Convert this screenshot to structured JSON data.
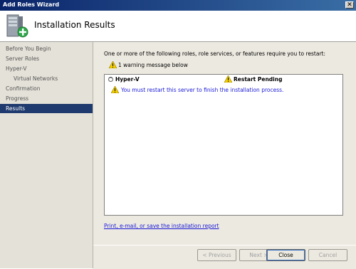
{
  "window": {
    "title": "Add Roles Wizard",
    "close_glyph": "✕"
  },
  "header": {
    "title": "Installation Results",
    "icon": "server-add-icon"
  },
  "sidebar": {
    "items": [
      {
        "label": "Before You Begin",
        "active": false,
        "sub": false
      },
      {
        "label": "Server Roles",
        "active": false,
        "sub": false
      },
      {
        "label": "Hyper-V",
        "active": false,
        "sub": false
      },
      {
        "label": "Virtual Networks",
        "active": false,
        "sub": true
      },
      {
        "label": "Confirmation",
        "active": false,
        "sub": false
      },
      {
        "label": "Progress",
        "active": false,
        "sub": false
      },
      {
        "label": "Results",
        "active": true,
        "sub": false
      }
    ]
  },
  "main": {
    "intro": "One or more of the following roles, role services, or features require you to restart:",
    "warning_count": "1 warning message below",
    "results": [
      {
        "role": "Hyper-V",
        "status": "Restart Pending",
        "detail": "You must restart this server to finish the installation process."
      }
    ],
    "report_link": "Print, e-mail, or save the installation report"
  },
  "footer": {
    "previous": "< Previous",
    "next": "Next >",
    "close": "Close",
    "cancel": "Cancel"
  },
  "colors": {
    "accent": "#1f3a6e",
    "link": "#1a1ad8",
    "warning": "#f5d000"
  }
}
